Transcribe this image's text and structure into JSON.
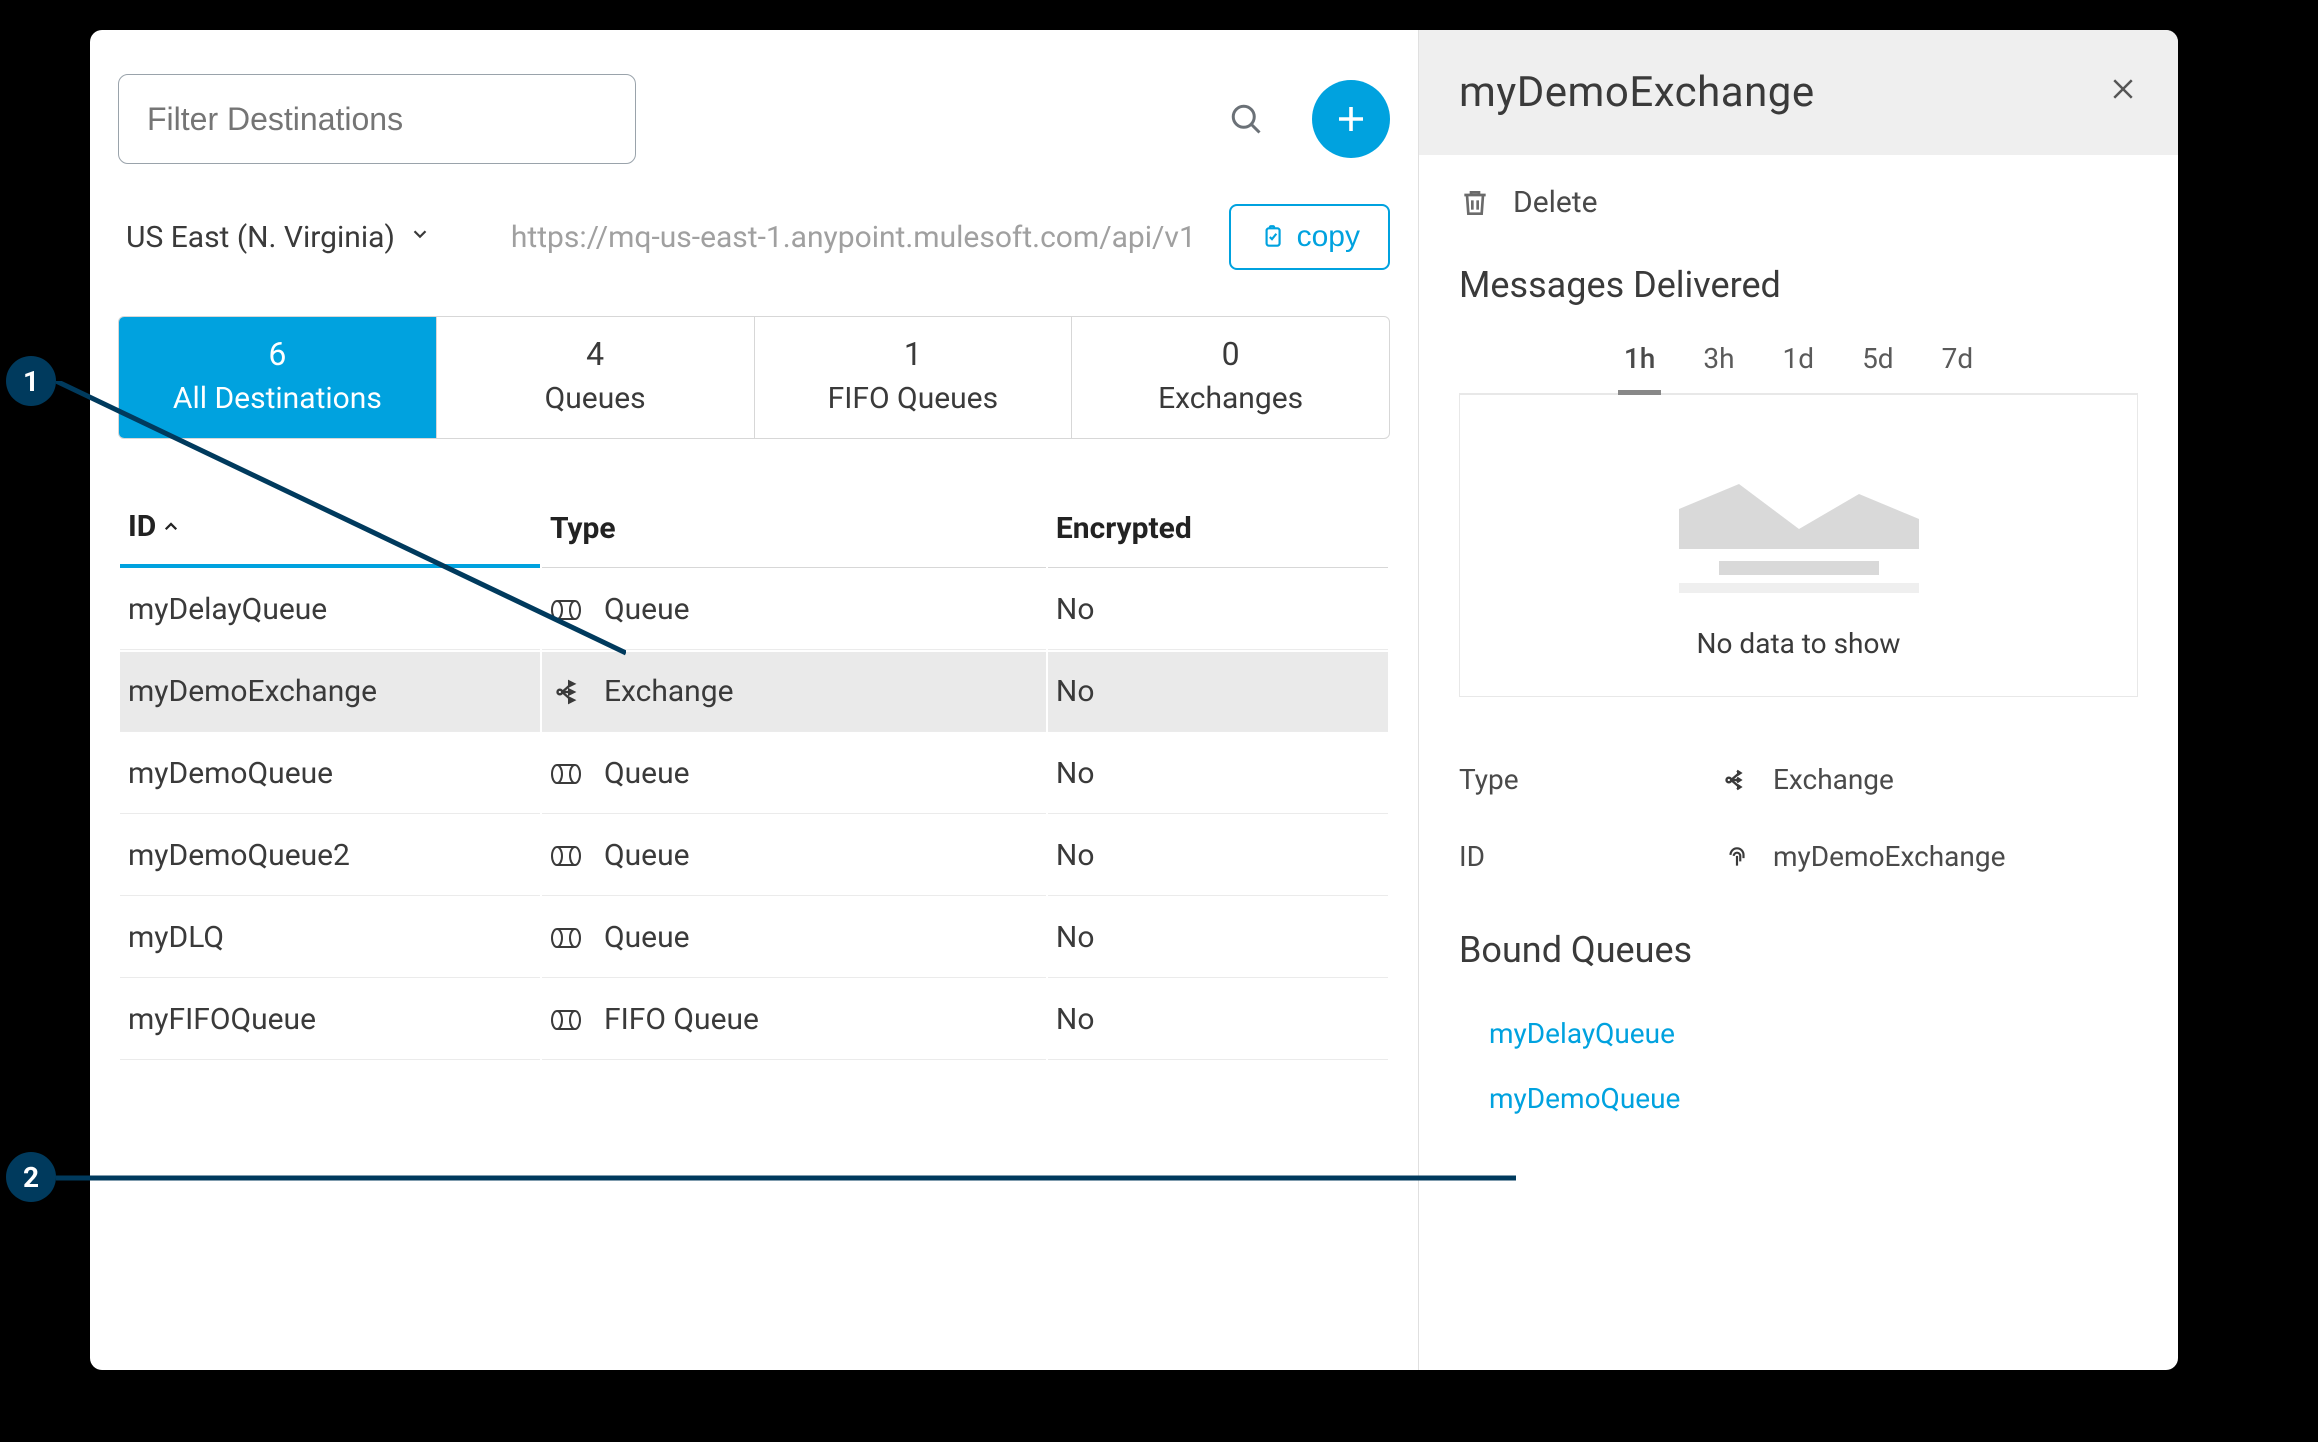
{
  "search": {
    "placeholder": "Filter Destinations"
  },
  "region": {
    "selected": "US East (N. Virginia)"
  },
  "api_url": "https://mq-us-east-1.anypoint.mulesoft.com/api/v1",
  "copy_label": "copy",
  "tabs": [
    {
      "count": "6",
      "label": "All Destinations"
    },
    {
      "count": "4",
      "label": "Queues"
    },
    {
      "count": "1",
      "label": "FIFO Queues"
    },
    {
      "count": "0",
      "label": "Exchanges"
    }
  ],
  "table": {
    "headers": {
      "id": "ID",
      "type": "Type",
      "encrypted": "Encrypted"
    },
    "rows": [
      {
        "id": "myDelayQueue",
        "type": "Queue",
        "encrypted": "No",
        "icon": "queue"
      },
      {
        "id": "myDemoExchange",
        "type": "Exchange",
        "encrypted": "No",
        "icon": "exchange",
        "selected": true
      },
      {
        "id": "myDemoQueue",
        "type": "Queue",
        "encrypted": "No",
        "icon": "queue"
      },
      {
        "id": "myDemoQueue2",
        "type": "Queue",
        "encrypted": "No",
        "icon": "queue"
      },
      {
        "id": "myDLQ",
        "type": "Queue",
        "encrypted": "No",
        "icon": "queue"
      },
      {
        "id": "myFIFOQueue",
        "type": "FIFO Queue",
        "encrypted": "No",
        "icon": "queue"
      }
    ]
  },
  "detail": {
    "title": "myDemoExchange",
    "delete_label": "Delete",
    "messages_heading": "Messages Delivered",
    "time_tabs": [
      "1h",
      "3h",
      "1d",
      "5d",
      "7d"
    ],
    "time_tab_active": "1h",
    "no_data": "No data to show",
    "props": {
      "type_label": "Type",
      "type_value": "Exchange",
      "id_label": "ID",
      "id_value": "myDemoExchange"
    },
    "bound_heading": "Bound Queues",
    "bound_queues": [
      "myDelayQueue",
      "myDemoQueue"
    ]
  },
  "callouts": {
    "1": "1",
    "2": "2"
  }
}
